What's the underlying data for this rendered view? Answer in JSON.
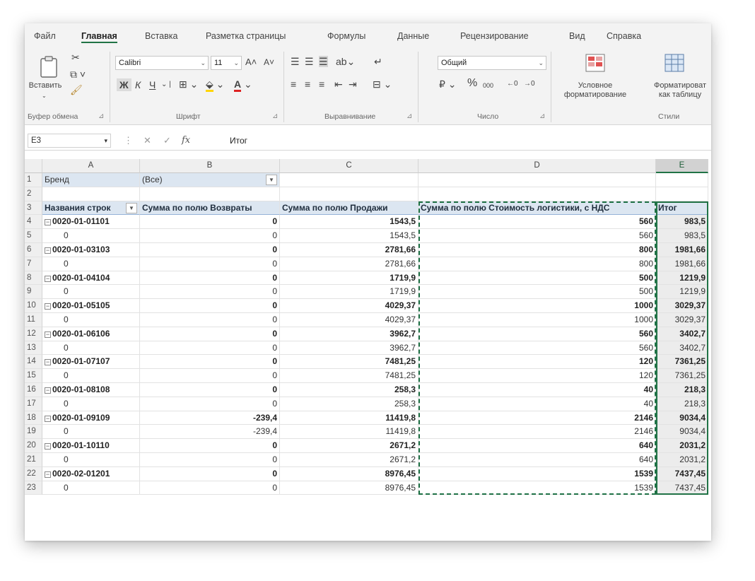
{
  "ribbon_tabs": [
    "Файл",
    "Главная",
    "Вставка",
    "Разметка страницы",
    "Формулы",
    "Данные",
    "Рецензирование",
    "Вид",
    "Справка"
  ],
  "ribbon": {
    "paste_label": "Вставить",
    "clipboard_group": "Буфер обмена",
    "font_name": "Calibri",
    "font_size": "11",
    "grow_font": "A˄",
    "shrink_font": "A˅",
    "bold": "Ж",
    "italic": "К",
    "underline": "Ч",
    "font_group": "Шрифт",
    "align_group": "Выравнивание",
    "number_format": "Общий",
    "percent": "%",
    "thousands": "000",
    "number_group": "Число",
    "cond_format_l1": "Условное",
    "cond_format_l2": "форматирование",
    "format_table_l1": "Форматироват",
    "format_table_l2": "как таблицу",
    "styles_group": "Стили"
  },
  "formula_bar": {
    "name_box": "E3",
    "fx": "fx",
    "value": "Итог"
  },
  "columns": [
    "A",
    "B",
    "C",
    "D",
    "E"
  ],
  "pivot": {
    "filter_label": "Бренд",
    "filter_value": "(Все)",
    "headers": [
      "Названия строк",
      "Сумма по полю Возвраты",
      "Сумма по полю Продажи",
      "Сумма по полю Стоимость логистики, с НДС",
      "Итог"
    ],
    "rows": [
      {
        "num": "4",
        "type": "group",
        "a": "0020-01-01101",
        "b": "0",
        "c": "1543,5",
        "d": "560",
        "e": "983,5"
      },
      {
        "num": "5",
        "type": "item",
        "a": "0",
        "b": "0",
        "c": "1543,5",
        "d": "560",
        "e": "983,5"
      },
      {
        "num": "6",
        "type": "group",
        "a": "0020-01-03103",
        "b": "0",
        "c": "2781,66",
        "d": "800",
        "e": "1981,66"
      },
      {
        "num": "7",
        "type": "item",
        "a": "0",
        "b": "0",
        "c": "2781,66",
        "d": "800",
        "e": "1981,66"
      },
      {
        "num": "8",
        "type": "group",
        "a": "0020-01-04104",
        "b": "0",
        "c": "1719,9",
        "d": "500",
        "e": "1219,9"
      },
      {
        "num": "9",
        "type": "item",
        "a": "0",
        "b": "0",
        "c": "1719,9",
        "d": "500",
        "e": "1219,9"
      },
      {
        "num": "10",
        "type": "group",
        "a": "0020-01-05105",
        "b": "0",
        "c": "4029,37",
        "d": "1000",
        "e": "3029,37"
      },
      {
        "num": "11",
        "type": "item",
        "a": "0",
        "b": "0",
        "c": "4029,37",
        "d": "1000",
        "e": "3029,37"
      },
      {
        "num": "12",
        "type": "group",
        "a": "0020-01-06106",
        "b": "0",
        "c": "3962,7",
        "d": "560",
        "e": "3402,7"
      },
      {
        "num": "13",
        "type": "item",
        "a": "0",
        "b": "0",
        "c": "3962,7",
        "d": "560",
        "e": "3402,7"
      },
      {
        "num": "14",
        "type": "group",
        "a": "0020-01-07107",
        "b": "0",
        "c": "7481,25",
        "d": "120",
        "e": "7361,25"
      },
      {
        "num": "15",
        "type": "item",
        "a": "0",
        "b": "0",
        "c": "7481,25",
        "d": "120",
        "e": "7361,25"
      },
      {
        "num": "16",
        "type": "group",
        "a": "0020-01-08108",
        "b": "0",
        "c": "258,3",
        "d": "40",
        "e": "218,3"
      },
      {
        "num": "17",
        "type": "item",
        "a": "0",
        "b": "0",
        "c": "258,3",
        "d": "40",
        "e": "218,3"
      },
      {
        "num": "18",
        "type": "group",
        "a": "0020-01-09109",
        "b": "-239,4",
        "c": "11419,8",
        "d": "2146",
        "e": "9034,4"
      },
      {
        "num": "19",
        "type": "item",
        "a": "0",
        "b": "-239,4",
        "c": "11419,8",
        "d": "2146",
        "e": "9034,4"
      },
      {
        "num": "20",
        "type": "group",
        "a": "0020-01-10110",
        "b": "0",
        "c": "2671,2",
        "d": "640",
        "e": "2031,2"
      },
      {
        "num": "21",
        "type": "item",
        "a": "0",
        "b": "0",
        "c": "2671,2",
        "d": "640",
        "e": "2031,2"
      },
      {
        "num": "22",
        "type": "group",
        "a": "0020-02-01201",
        "b": "0",
        "c": "8976,45",
        "d": "1539",
        "e": "7437,45"
      },
      {
        "num": "23",
        "type": "item",
        "a": "0",
        "b": "0",
        "c": "8976,45",
        "d": "1539",
        "e": "7437,45"
      }
    ]
  },
  "colors": {
    "accent": "#217346",
    "pivot_header_bg": "#dce6f1"
  }
}
